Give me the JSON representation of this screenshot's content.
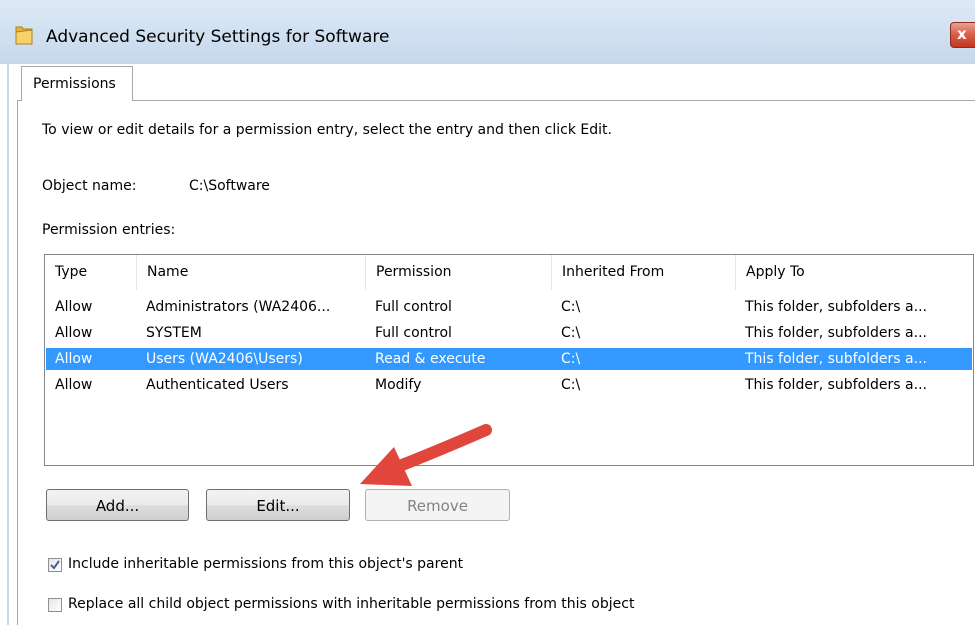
{
  "window": {
    "title": "Advanced Security Settings for Software",
    "close_glyph": "x"
  },
  "tabs": [
    {
      "label": "Permissions"
    }
  ],
  "instructions": "To view or edit details for a permission entry, select the entry and then click Edit.",
  "object_name": {
    "label": "Object name:",
    "value": "C:\\Software"
  },
  "permission_entries": {
    "label": "Permission entries:",
    "columns": [
      "Type",
      "Name",
      "Permission",
      "Inherited From",
      "Apply To"
    ],
    "rows": [
      [
        "Allow",
        "Administrators (WA2406...",
        "Full control",
        "C:\\",
        "This folder, subfolders a..."
      ],
      [
        "Allow",
        "SYSTEM",
        "Full control",
        "C:\\",
        "This folder, subfolders a..."
      ],
      [
        "Allow",
        "Users (WA2406\\Users)",
        "Read & execute",
        "C:\\",
        "This folder, subfolders a..."
      ],
      [
        "Allow",
        "Authenticated Users",
        "Modify",
        "C:\\",
        "This folder, subfolders a..."
      ]
    ],
    "selected_row": 2
  },
  "buttons": {
    "add": "Add...",
    "edit": "Edit...",
    "remove": "Remove"
  },
  "checkboxes": {
    "include_inheritable": {
      "label": "Include inheritable permissions from this object's parent",
      "checked": true
    },
    "replace_child": {
      "label": "Replace all child object permissions with inheritable permissions from this object",
      "checked": false
    }
  },
  "icons": {
    "window": "folder-icon",
    "check": "checkmark-icon",
    "annotation": "red-arrow-icon"
  },
  "colors": {
    "selection": "#3399ff",
    "annotation_arrow": "#e0463c",
    "title_bar": "#cfdff0"
  }
}
